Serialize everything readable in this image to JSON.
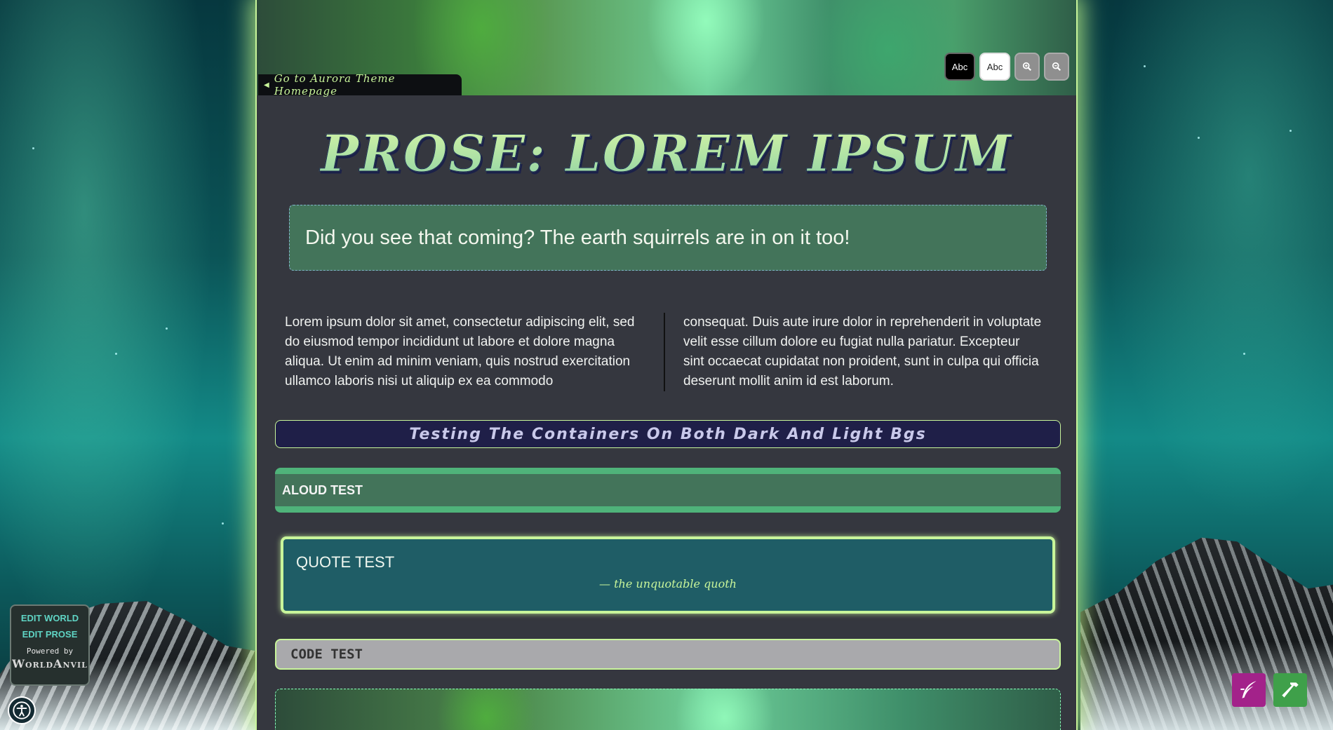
{
  "header": {
    "home_link": "Go to Aurora Theme Homepage",
    "toolbar": {
      "dark_label": "Abc",
      "light_label": "Abc",
      "zoom_in_icon": "zoom-in-icon",
      "zoom_out_icon": "zoom-out-icon"
    }
  },
  "article": {
    "title": "PROSE: LOREM IPSUM",
    "subtitle": "Did you see that coming? The earth squirrels are in on it too!",
    "col_left": "Lorem ipsum dolor sit amet, consectetur adipiscing elit, sed do eiusmod tempor incididunt ut labore et dolore magna aliqua. Ut enim ad minim veniam, quis nostrud exercitation ullamco laboris nisi ut aliquip ex ea commodo",
    "col_right": "consequat. Duis aute irure dolor in reprehenderit in voluptate velit esse cillum dolore eu fugiat nulla pariatur. Excepteur sint occaecat cupidatat non proident, sunt in culpa qui officia deserunt mollit anim id est laborum.",
    "container_title": "Testing The Containers On Both Dark And Light Bgs",
    "aloud": "ALOUD TEST",
    "quote": {
      "text": "QUOTE TEST",
      "author": "— the unquotable quoth"
    },
    "code": "CODE TEST"
  },
  "widget": {
    "edit_world": "EDIT WORLD",
    "edit_prose": "EDIT PROSE",
    "powered_by": "Powered by",
    "logo_text": "WorldAnvil"
  },
  "floating_buttons": {
    "quill_icon": "quill-icon",
    "hammer_icon": "hammer-icon"
  },
  "colors": {
    "accent": "#c8f59a",
    "page_bg": "#35373f",
    "green_box": "#43745a",
    "navy_box": "#1f1f48",
    "teal_quote": "#1f5d66"
  }
}
